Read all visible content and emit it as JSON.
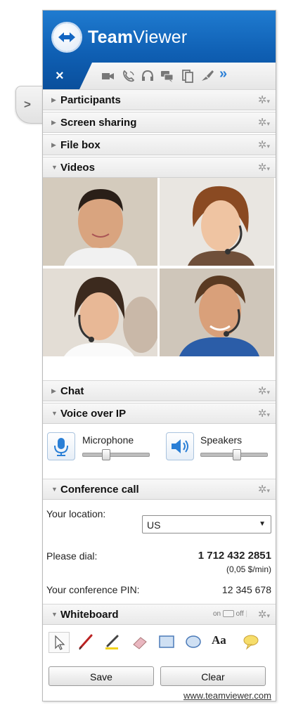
{
  "app": {
    "brand_bold": "Team",
    "brand_light": "Viewer"
  },
  "toolbar": {
    "close_label": "×",
    "expand_label": "»",
    "icons": [
      "video-camera-icon",
      "phone-icon",
      "headset-icon",
      "chat-icon",
      "file-icon",
      "whiteboard-icon",
      "expand-icon"
    ]
  },
  "sections": {
    "participants": "Participants",
    "screen_sharing": "Screen sharing",
    "file_box": "File box",
    "videos": "Videos",
    "chat": "Chat",
    "voip": "Voice over IP",
    "conference": "Conference call",
    "whiteboard": "Whiteboard"
  },
  "voip": {
    "microphone": "Microphone",
    "microphone_level": 0.33,
    "speakers": "Speakers",
    "speakers_level": 0.55
  },
  "conference": {
    "location_label": "Your location:",
    "location_value": "US",
    "dial_label": "Please dial:",
    "dial_number": "1 712 432 2851",
    "dial_rate": "(0,05 $/min)",
    "pin_label": "Your conference PIN:",
    "pin_value": "12 345 678"
  },
  "whiteboard": {
    "on_label": "on",
    "off_label": "off",
    "text_tool": "Aa",
    "save": "Save",
    "clear": "Clear",
    "tools": [
      "pointer-icon",
      "pen-icon",
      "highlighter-icon",
      "eraser-icon",
      "rectangle-icon",
      "ellipse-icon",
      "text-icon",
      "speech-bubble-icon"
    ]
  },
  "footer": {
    "link": "www.teamviewer.com"
  },
  "colors": {
    "brand_blue": "#0f5fb3",
    "accent_blue": "#2a7fd6"
  }
}
